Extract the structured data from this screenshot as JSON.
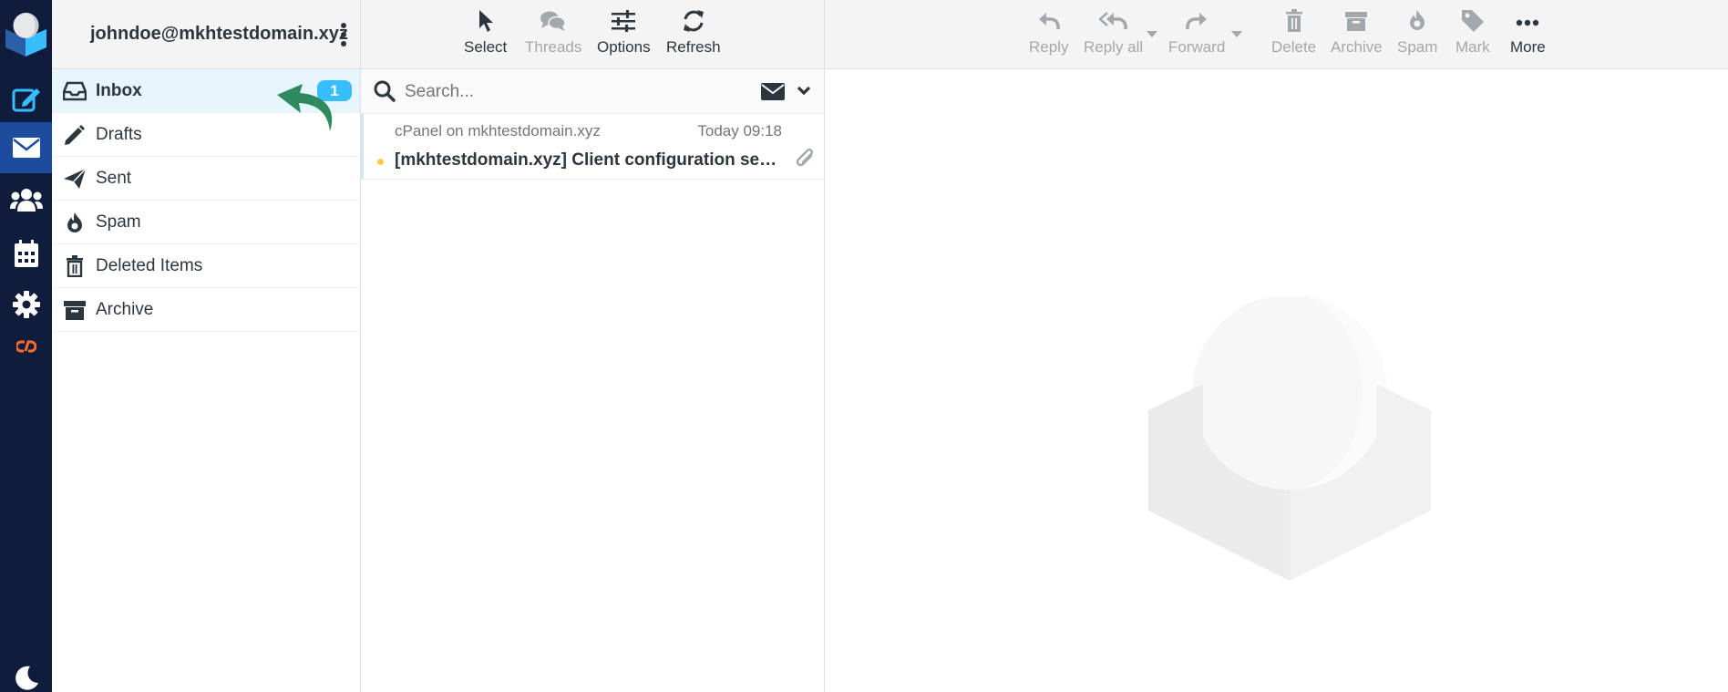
{
  "account": {
    "email": "johndoe@mkhtestdomain.xyz"
  },
  "colors": {
    "rail_bg": "#0f1c3c",
    "rail_active": "#1d4c9e",
    "accent": "#37beff",
    "unread_dot": "#ffc84a",
    "cpanel": "#ff6c2c"
  },
  "rail": {
    "items": [
      {
        "icon": "compose-icon"
      },
      {
        "icon": "mail-icon",
        "active": true
      },
      {
        "icon": "contacts-icon"
      },
      {
        "icon": "calendar-icon"
      },
      {
        "icon": "settings-icon"
      },
      {
        "icon": "cpanel-icon"
      },
      {
        "icon": "dark-mode-moon-icon"
      }
    ]
  },
  "folders": [
    {
      "label": "Inbox",
      "icon": "inbox-icon",
      "unread": "1",
      "active": true
    },
    {
      "label": "Drafts",
      "icon": "pencil-icon"
    },
    {
      "label": "Sent",
      "icon": "paper-plane-icon"
    },
    {
      "label": "Spam",
      "icon": "fire-icon"
    },
    {
      "label": "Deleted Items",
      "icon": "trash-icon"
    },
    {
      "label": "Archive",
      "icon": "archive-box-icon"
    }
  ],
  "list_toolbar": {
    "select": "Select",
    "threads": "Threads",
    "options": "Options",
    "refresh": "Refresh"
  },
  "search": {
    "placeholder": "Search..."
  },
  "messages": [
    {
      "from": "cPanel on mkhtestdomain.xyz",
      "date": "Today 09:18",
      "subject": "[mkhtestdomain.xyz] Client configuration settings for “johndoe@mkhtestdomain.xyz”.",
      "unread": true,
      "attachment": true
    }
  ],
  "preview_toolbar": {
    "reply": "Reply",
    "reply_all": "Reply all",
    "forward": "Forward",
    "delete": "Delete",
    "archive": "Archive",
    "spam": "Spam",
    "mark": "Mark",
    "more": "More"
  }
}
